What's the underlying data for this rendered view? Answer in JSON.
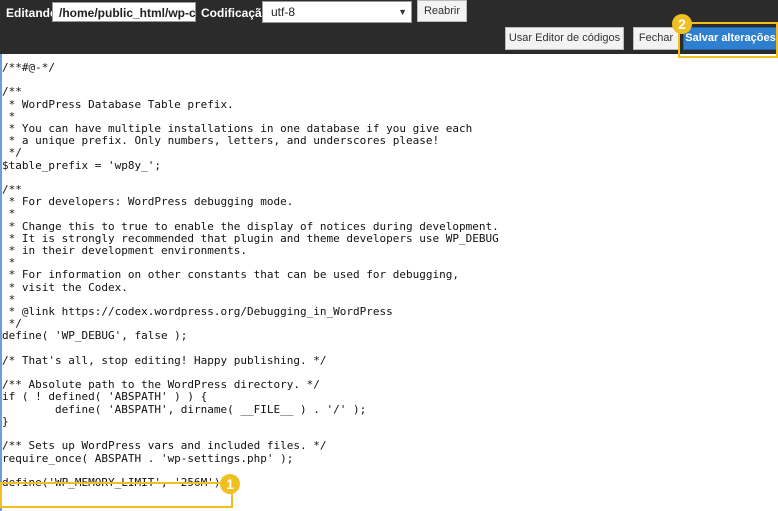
{
  "toolbar": {
    "editing_label": "Editando:",
    "path_value": "/home/public_html/wp-co",
    "encoding_label": "Codificação:",
    "encoding_value": "utf-8",
    "reopen_label": "Reabrir",
    "code_editor_label": "Usar Editor de códigos",
    "close_label": "Fechar",
    "save_label": "Salvar alterações"
  },
  "editor": {
    "code": "/**#@-*/\n\n/**\n * WordPress Database Table prefix.\n *\n * You can have multiple installations in one database if you give each\n * a unique prefix. Only numbers, letters, and underscores please!\n */\n$table_prefix = 'wp8y_';\n\n/**\n * For developers: WordPress debugging mode.\n *\n * Change this to true to enable the display of notices during development.\n * It is strongly recommended that plugin and theme developers use WP_DEBUG\n * in their development environments.\n *\n * For information on other constants that can be used for debugging,\n * visit the Codex.\n *\n * @link https://codex.wordpress.org/Debugging_in_WordPress\n */\ndefine( 'WP_DEBUG', false );\n\n/* That's all, stop editing! Happy publishing. */\n\n/** Absolute path to the WordPress directory. */\nif ( ! defined( 'ABSPATH' ) ) {\n        define( 'ABSPATH', dirname( __FILE__ ) . '/' );\n}\n\n/** Sets up WordPress vars and included files. */\nrequire_once( ABSPATH . 'wp-settings.php' );\n\ndefine('WP_MEMORY_LIMIT', '256M');"
  },
  "callouts": {
    "one": "1",
    "two": "2",
    "color": "#f0c020"
  },
  "colors": {
    "topbar": "#2b2b2b",
    "primary_button": "#2f7fd0"
  }
}
